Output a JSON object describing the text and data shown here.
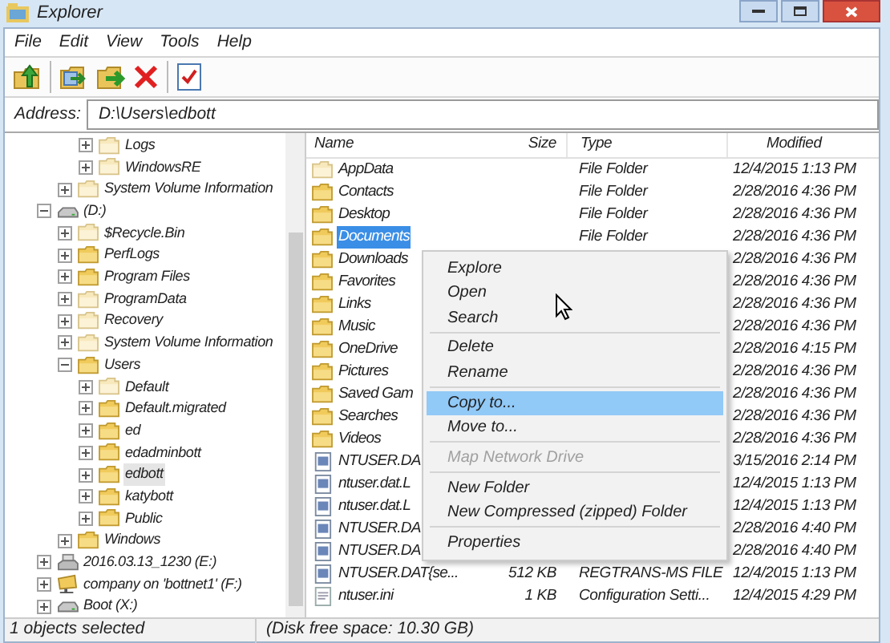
{
  "window": {
    "title": "Explorer"
  },
  "menu": [
    "File",
    "Edit",
    "View",
    "Tools",
    "Help"
  ],
  "address": {
    "label": "Address:",
    "value": "D:\\Users\\edbott"
  },
  "tree": [
    {
      "children": [
        {
          "children": [
            {
              "label": "Logs",
              "kind": "hidden_folder",
              "expanded": false,
              "selected": false
            },
            {
              "label": "WindowsRE",
              "kind": "hidden_folder",
              "expanded": false,
              "selected": false
            }
          ]
        },
        {
          "label": "System Volume Information",
          "kind": "hidden_folder",
          "expanded": false,
          "selected": false
        }
      ]
    },
    {
      "label": "(D:)",
      "kind": "drive",
      "expanded": true,
      "selected": false,
      "children": [
        {
          "label": "$Recycle.Bin",
          "kind": "hidden_folder",
          "expanded": false,
          "selected": false
        },
        {
          "label": "PerfLogs",
          "kind": "folder",
          "expanded": false,
          "selected": false
        },
        {
          "label": "Program Files",
          "kind": "folder",
          "expanded": false,
          "selected": false
        },
        {
          "label": "ProgramData",
          "kind": "hidden_folder",
          "expanded": false,
          "selected": false
        },
        {
          "label": "Recovery",
          "kind": "hidden_folder",
          "expanded": false,
          "selected": false
        },
        {
          "label": "System Volume Information",
          "kind": "hidden_folder",
          "expanded": false,
          "selected": false
        },
        {
          "label": "Users",
          "kind": "folder",
          "expanded": true,
          "selected": false,
          "children": [
            {
              "label": "Default",
              "kind": "hidden_folder",
              "expanded": false,
              "selected": false
            },
            {
              "label": "Default.migrated",
              "kind": "folder",
              "expanded": false,
              "selected": false
            },
            {
              "label": "ed",
              "kind": "folder",
              "expanded": false,
              "selected": false
            },
            {
              "label": "edadminbott",
              "kind": "folder",
              "expanded": false,
              "selected": false
            },
            {
              "label": "edbott",
              "kind": "folder",
              "expanded": false,
              "selected": true
            },
            {
              "label": "katybott",
              "kind": "folder",
              "expanded": false,
              "selected": false
            },
            {
              "label": "Public",
              "kind": "folder",
              "expanded": false,
              "selected": false
            }
          ]
        },
        {
          "label": "Windows",
          "kind": "folder",
          "expanded": false,
          "selected": false
        }
      ]
    },
    {
      "label": "2016.03.13_1230 (E:)",
      "kind": "usb",
      "expanded": false,
      "selected": false
    },
    {
      "label": "company on 'bottnet1' (F:)",
      "kind": "network",
      "expanded": false,
      "selected": false
    },
    {
      "label": "Boot (X:)",
      "kind": "drive",
      "expanded": false,
      "selected": false
    }
  ],
  "list": {
    "columns": [
      "Name",
      "Size",
      "Type",
      "Modified"
    ],
    "rows": [
      {
        "kind": "hidden_folder",
        "name": "AppData",
        "type": "File Folder",
        "modified": "12/4/2015 1:13 PM",
        "selected": false
      },
      {
        "kind": "folder",
        "name": "Contacts",
        "type": "File Folder",
        "modified": "2/28/2016 4:36 PM",
        "selected": false
      },
      {
        "kind": "folder",
        "name": "Desktop",
        "type": "File Folder",
        "modified": "2/28/2016 4:36 PM",
        "selected": false
      },
      {
        "kind": "folder",
        "name": "Documents",
        "type": "File Folder",
        "modified": "2/28/2016 4:36 PM",
        "selected": true
      },
      {
        "kind": "folder",
        "name": "Downloads",
        "modified": "2/28/2016 4:36 PM",
        "selected": false
      },
      {
        "kind": "folder",
        "name": "Favorites",
        "modified": "2/28/2016 4:36 PM",
        "selected": false
      },
      {
        "kind": "folder",
        "name": "Links",
        "modified": "2/28/2016 4:36 PM",
        "selected": false
      },
      {
        "kind": "folder",
        "name": "Music",
        "modified": "2/28/2016 4:36 PM",
        "selected": false
      },
      {
        "kind": "folder",
        "name": "OneDrive",
        "modified": "2/28/2016 4:15 PM",
        "selected": false
      },
      {
        "kind": "folder",
        "name": "Pictures",
        "modified": "2/28/2016 4:36 PM",
        "selected": false
      },
      {
        "kind": "folder",
        "name": "Saved Gam",
        "modified": "2/28/2016 4:36 PM",
        "selected": false
      },
      {
        "kind": "folder",
        "name": "Searches",
        "modified": "2/28/2016 4:36 PM",
        "selected": false
      },
      {
        "kind": "folder",
        "name": "Videos",
        "modified": "2/28/2016 4:36 PM",
        "selected": false
      },
      {
        "kind": "registry_file",
        "name": "NTUSER.DA",
        "modified": "3/15/2016 2:14 PM",
        "selected": false
      },
      {
        "kind": "registry_file",
        "name": "ntuser.dat.L",
        "modified": "12/4/2015 1:13 PM",
        "selected": false
      },
      {
        "kind": "registry_file",
        "name": "ntuser.dat.L",
        "modified": "12/4/2015 1:13 PM",
        "selected": false
      },
      {
        "kind": "registry_file",
        "name": "NTUSER.DA",
        "modified": "2/28/2016 4:40 PM",
        "selected": false
      },
      {
        "kind": "registry_file",
        "name": "NTUSER.DA",
        "modified": "2/28/2016 4:40 PM",
        "selected": false
      },
      {
        "kind": "registry_file",
        "name": "NTUSER.DAT{se...",
        "size": "512 KB",
        "type": "REGTRANS-MS FILE",
        "modified": "12/4/2015 1:13 PM",
        "selected": false
      },
      {
        "kind": "text_file",
        "name": "ntuser.ini",
        "size": "1 KB",
        "type": "Configuration Setti...",
        "modified": "12/4/2015 4:29 PM",
        "selected": false
      }
    ]
  },
  "context_menu": [
    {
      "kind": "item",
      "label": "Explore",
      "selected": false,
      "disabled": false
    },
    {
      "kind": "item",
      "label": "Open",
      "selected": false,
      "disabled": false
    },
    {
      "kind": "item",
      "label": "Search",
      "selected": false,
      "disabled": false
    },
    {
      "kind": "separator"
    },
    {
      "kind": "item",
      "label": "Delete",
      "selected": false,
      "disabled": false
    },
    {
      "kind": "item",
      "label": "Rename",
      "selected": false,
      "disabled": false
    },
    {
      "kind": "separator"
    },
    {
      "kind": "item",
      "label": "Copy to...",
      "selected": true,
      "disabled": false
    },
    {
      "kind": "item",
      "label": "Move to...",
      "selected": false,
      "disabled": false
    },
    {
      "kind": "separator"
    },
    {
      "kind": "item",
      "label": "Map Network Drive",
      "selected": false,
      "disabled": true
    },
    {
      "kind": "separator"
    },
    {
      "kind": "item",
      "label": "New Folder",
      "selected": false,
      "disabled": false
    },
    {
      "kind": "item",
      "label": "New Compressed (zipped) Folder",
      "selected": false,
      "disabled": false
    },
    {
      "kind": "separator"
    },
    {
      "kind": "item",
      "label": "Properties",
      "selected": false,
      "disabled": false
    }
  ],
  "status_bar": [
    "1 objects selected",
    "(Disk free space: 10.30 GB)"
  ]
}
